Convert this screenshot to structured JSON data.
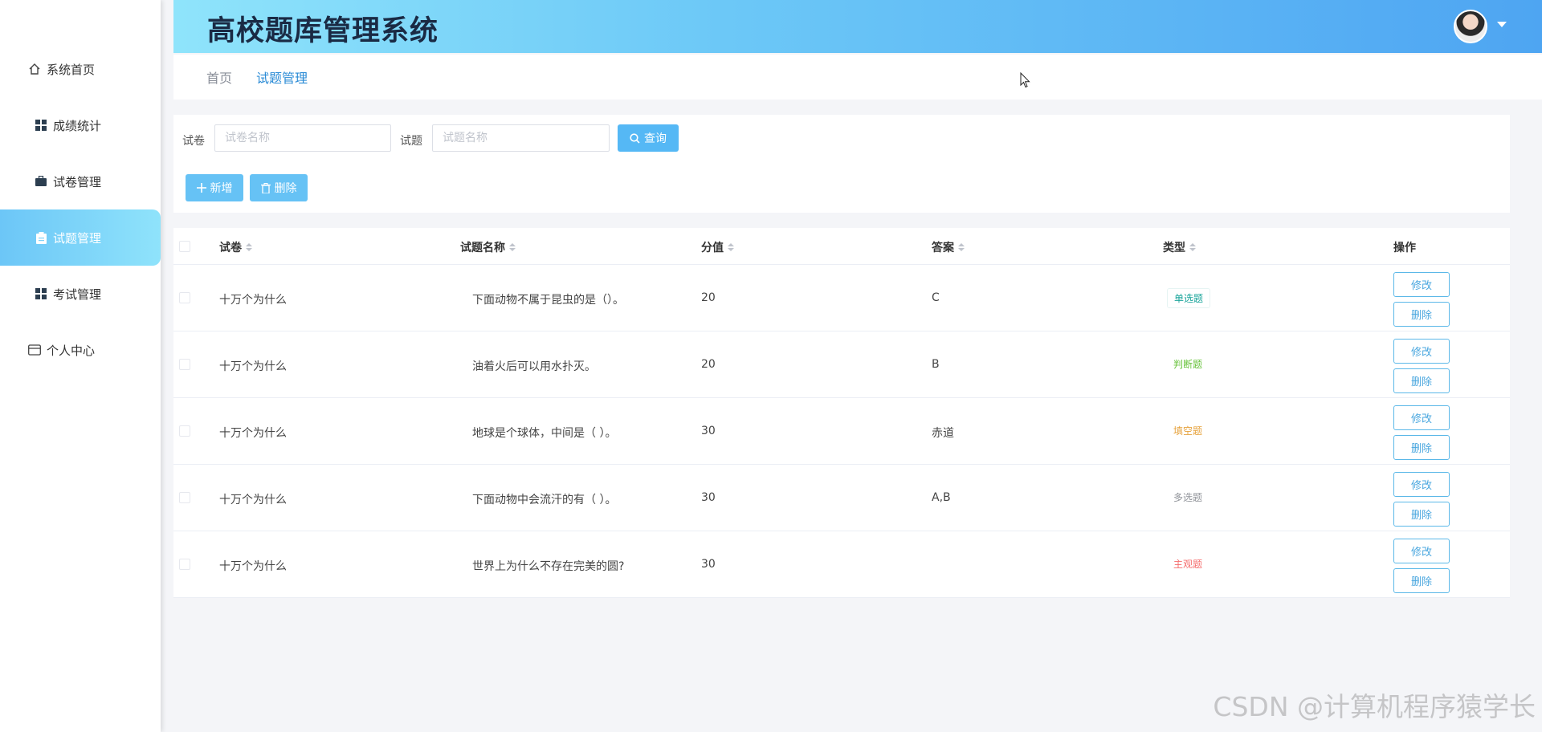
{
  "app": {
    "title": "高校题库管理系统"
  },
  "sidebar": {
    "items": [
      {
        "label": "系统首页",
        "icon": "home-icon"
      },
      {
        "label": "成绩统计",
        "icon": "grid-icon"
      },
      {
        "label": "试卷管理",
        "icon": "briefcase-icon"
      },
      {
        "label": "试题管理",
        "icon": "clipboard-icon",
        "active": true
      },
      {
        "label": "考试管理",
        "icon": "grid-icon"
      },
      {
        "label": "个人中心",
        "icon": "card-icon"
      }
    ]
  },
  "breadcrumb": {
    "home": "首页",
    "current": "试题管理"
  },
  "search": {
    "paper_label": "试卷",
    "paper_placeholder": "试卷名称",
    "question_label": "试题",
    "question_placeholder": "试题名称",
    "query_label": "查询"
  },
  "toolbar": {
    "add_label": "新增",
    "delete_label": "删除"
  },
  "table": {
    "columns": [
      "试卷",
      "试题名称",
      "分值",
      "答案",
      "类型",
      "操作"
    ],
    "rows": [
      {
        "paper": "十万个为什么",
        "question": "下面动物不属于昆虫的是（）。",
        "score": "20",
        "answer": "C",
        "type": "单选题"
      },
      {
        "paper": "十万个为什么",
        "question": "油着火后可以用水扑灭。",
        "score": "20",
        "answer": "B",
        "type": "判断题"
      },
      {
        "paper": "十万个为什么",
        "question": "地球是个球体，中间是（ ）。",
        "score": "30",
        "answer": "赤道",
        "type": "填空题"
      },
      {
        "paper": "十万个为什么",
        "question": "下面动物中会流汗的有（ ）。",
        "score": "30",
        "answer": "A,B",
        "type": "多选题"
      },
      {
        "paper": "十万个为什么",
        "question": "世界上为什么不存在完美的圆?",
        "score": "30",
        "answer": "",
        "type": "主观题"
      }
    ],
    "edit_label": "修改",
    "delete_label": "删除"
  },
  "tag_colors": {
    "单选题": "#1aa59b",
    "判断题": "#67c23a",
    "填空题": "#e6a23c",
    "多选题": "#909399",
    "主观题": "#f56c6c"
  },
  "watermark": "CSDN @计算机程序猿学长"
}
